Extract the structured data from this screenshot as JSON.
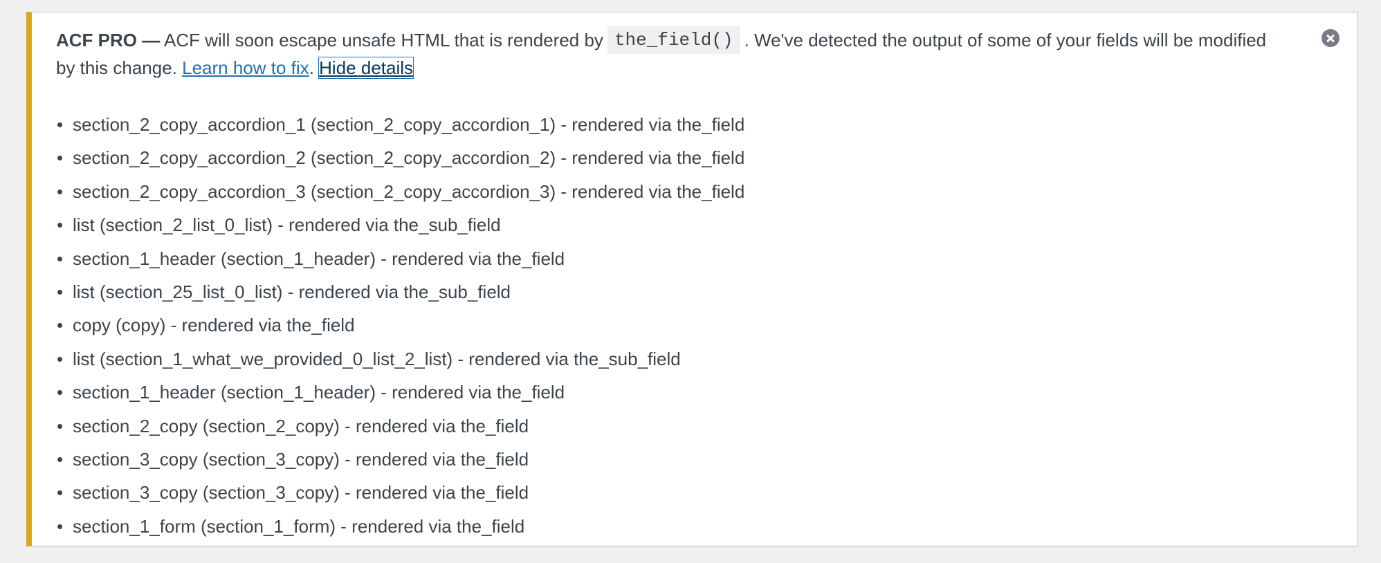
{
  "notice": {
    "brand": "ACF PRO —",
    "text_before_code": "ACF will soon escape unsafe HTML that is rendered by",
    "code": "the_field()",
    "text_after_code": ". We've detected the output of some of your fields will be modified by this change.",
    "learn_link": "Learn how to fix",
    "separator": ".",
    "hide_link": "Hide details",
    "dismiss_icon": "close-circle-icon",
    "accent_color": "#dba617",
    "link_color": "#2271b1"
  },
  "fields": [
    "section_2_copy_accordion_1 (section_2_copy_accordion_1) - rendered via the_field",
    "section_2_copy_accordion_2 (section_2_copy_accordion_2) - rendered via the_field",
    "section_2_copy_accordion_3 (section_2_copy_accordion_3) - rendered via the_field",
    "list (section_2_list_0_list) - rendered via the_sub_field",
    "section_1_header (section_1_header) - rendered via the_field",
    "list (section_25_list_0_list) - rendered via the_sub_field",
    "copy (copy) - rendered via the_field",
    "list (section_1_what_we_provided_0_list_2_list) - rendered via the_sub_field",
    "section_1_header (section_1_header) - rendered via the_field",
    "section_2_copy (section_2_copy) - rendered via the_field",
    "section_3_copy (section_3_copy) - rendered via the_field",
    "section_3_copy (section_3_copy) - rendered via the_field",
    "section_1_form (section_1_form) - rendered via the_field"
  ]
}
